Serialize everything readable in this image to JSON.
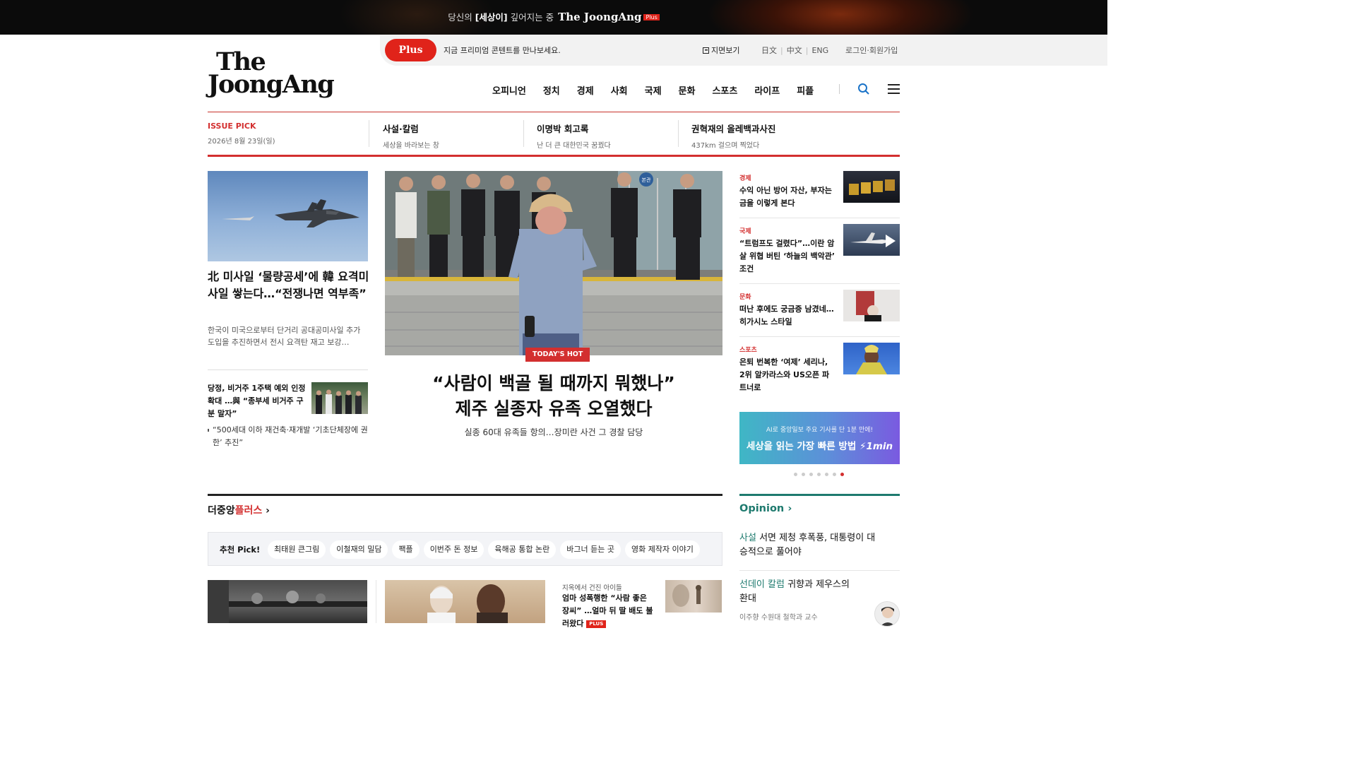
{
  "banner": {
    "pre": "당신의 ",
    "bold": "[세상이]",
    "post": " 깊어지는 중",
    "brand": "The JoongAng",
    "plus": "Plus"
  },
  "topbar": {
    "plus_button": "Plus",
    "plus_message": "지금 프리미엄 콘텐트를 만나보세요.",
    "paper_view": "지면보기",
    "langs": [
      "日文",
      "中文",
      "ENG"
    ],
    "login": "로그인·회원가입"
  },
  "logo": {
    "line1": "The",
    "line2": "JoongAng"
  },
  "nav": [
    "오피니언",
    "정치",
    "경제",
    "사회",
    "국제",
    "문화",
    "스포츠",
    "라이프",
    "피플"
  ],
  "issue_pick": [
    {
      "title": "ISSUE PICK",
      "sub": "2026년 8월 23일(일)"
    },
    {
      "title": "사설·칼럼",
      "sub": "세상을 바라보는 창"
    },
    {
      "title": "이명박 회고록",
      "sub": "난 더 큰 대한민국 꿈꿨다"
    },
    {
      "title": "권혁재의 올레백과사진",
      "sub": "437km 걸으며 찍었다"
    }
  ],
  "left": {
    "headline": "北 미사일 ‘물량공세’에 韓 요격미사일 쌓는다…“전쟁나면 역부족”",
    "summary": "한국이 미국으로부터 단거리 공대공미사일 추가 도입을 추진하면서 전시 요격탄 재고 보강…",
    "second_headline": "당정, 비거주 1주택 예외 인정 확대 …與 “종부세 비거주 구분 말자”",
    "second_bullet": "“500세대 이하 재건축·재개발 ‘기초단체장에 권한’ 추진”"
  },
  "main": {
    "badge": "TODAY'S HOT",
    "headline_1": "“사람이 백골 될 때까지 뭐했나”",
    "headline_2": "제주 실종자 유족 오열했다",
    "sub": "실종 60대 유족들 항의…장미란 사건 그 경찰 담당",
    "sign": "본관"
  },
  "right": [
    {
      "cat": "경제",
      "title": "수익 아닌 방어 자산, 부자는 금을 이렇게 본다"
    },
    {
      "cat": "국제",
      "title": "“트럼프도 걸렸다”…이란 암살 위협 버틴 ‘하늘의 백악관’ 조건"
    },
    {
      "cat": "문화",
      "title": "떠난 후에도 궁금증 남겼네… 히가시노 스타일"
    },
    {
      "cat": "스포츠",
      "title": "은퇴 번복한 ‘여제’ 세리나, 2위 알카라스와 US오픈 파트너로"
    }
  ],
  "ad": {
    "line1": "AI로 중앙일보 주요 기사를 단 1분 만에!",
    "line2": "세상을 읽는 가장 빠른 방법",
    "brand": "1min"
  },
  "carousel": {
    "count": 7,
    "active": 7
  },
  "plus_section": {
    "title_a": "더중앙",
    "title_b": "플러스",
    "pick_label": "추천 Pick!",
    "chips": [
      "최태원 큰그림",
      "이철재의 밀담",
      "팩플",
      "이번주 돈 정보",
      "육해공 통합 논란",
      "바그너 듣는 곳",
      "영화 제작자 이야기"
    ],
    "card3_cat": "지옥에서 건진 아이들",
    "card3_title": "엄마 성폭행한 “사람 좋은 장씨” …얼마 뒤 딸 배도 불러왔다",
    "card3_plus": "PLUS"
  },
  "opinion": {
    "title": "Opinion",
    "items": [
      {
        "kind": "사설",
        "text": "서면 제청 후폭풍, 대통령이 대승적으로 풀어야"
      },
      {
        "kind": "선데이 칼럼",
        "text": "귀향과 제우스의 환대",
        "author": "이주향 수원대 철학과 교수"
      }
    ]
  },
  "colors": {
    "accent": "#d32f2f",
    "opinion": "#1e7a6e"
  }
}
